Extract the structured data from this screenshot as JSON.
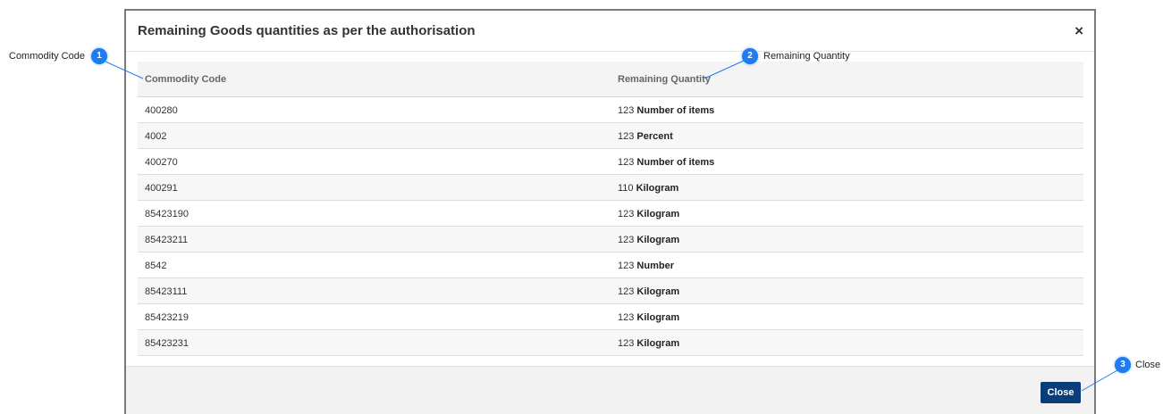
{
  "modal": {
    "title": "Remaining Goods quantities as per the authorisation",
    "close_icon": "×"
  },
  "table": {
    "headers": [
      "Commodity Code",
      "Remaining Quantity"
    ],
    "rows": [
      {
        "code": "400280",
        "quantity": "123",
        "unit": "Number of items"
      },
      {
        "code": "4002",
        "quantity": "123",
        "unit": "Percent"
      },
      {
        "code": "400270",
        "quantity": "123",
        "unit": "Number of items"
      },
      {
        "code": "400291",
        "quantity": "110",
        "unit": "Kilogram"
      },
      {
        "code": "85423190",
        "quantity": "123",
        "unit": "Kilogram"
      },
      {
        "code": "85423211",
        "quantity": "123",
        "unit": "Kilogram"
      },
      {
        "code": "8542",
        "quantity": "123",
        "unit": "Number"
      },
      {
        "code": "85423111",
        "quantity": "123",
        "unit": "Kilogram"
      },
      {
        "code": "85423219",
        "quantity": "123",
        "unit": "Kilogram"
      },
      {
        "code": "85423231",
        "quantity": "123",
        "unit": "Kilogram"
      }
    ]
  },
  "footer": {
    "close_label": "Close"
  },
  "callouts": [
    {
      "number": "1",
      "label": "Commodity Code"
    },
    {
      "number": "2",
      "label": "Remaining Quantity"
    },
    {
      "number": "3",
      "label": "Close"
    }
  ],
  "colors": {
    "accent": "#1e7cf0",
    "button": "#0b3d7a"
  }
}
